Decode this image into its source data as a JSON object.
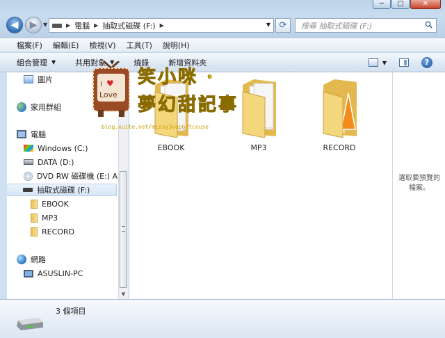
{
  "window": {
    "buttons": [
      "─",
      "□",
      "✕"
    ]
  },
  "navigation": {
    "address": {
      "root_label": "電腦",
      "current_label": "抽取式磁碟 (F:)"
    },
    "search": {
      "placeholder": "搜尋 抽取式磁碟 (F:)"
    }
  },
  "menu": [
    "檔案(F)",
    "編輯(E)",
    "檢視(V)",
    "工具(T)",
    "說明(H)"
  ],
  "commandbar": {
    "organize": "組合管理",
    "share": "共用對象",
    "burn": "燒錄",
    "new_folder": "新增資料夾"
  },
  "navpane": {
    "items": [
      {
        "label": "圖片",
        "icon": "pictures-icon"
      },
      {
        "label": "家用群組",
        "icon": "homegroup-icon"
      },
      {
        "label": "電腦",
        "icon": "computer-icon"
      },
      {
        "label": "Windows (C:)",
        "icon": "windows-drive-icon"
      },
      {
        "label": "DATA (D:)",
        "icon": "drive-icon"
      },
      {
        "label": "DVD RW 磁碟機 (E:) Au",
        "icon": "dvd-icon"
      },
      {
        "label": "抽取式磁碟 (F:)",
        "icon": "usb-drive-icon"
      },
      {
        "label": "EBOOK",
        "icon": "folder-icon"
      },
      {
        "label": "MP3",
        "icon": "folder-icon"
      },
      {
        "label": "RECORD",
        "icon": "folder-icon"
      },
      {
        "label": "網路",
        "icon": "network-icon"
      },
      {
        "label": "ASUSLIN-PC",
        "icon": "pc-icon"
      }
    ]
  },
  "folders": [
    {
      "name": "EBOOK"
    },
    {
      "name": "MP3"
    },
    {
      "name": "RECORD"
    }
  ],
  "preview_pane": {
    "message": "選取要預覽的檔案。"
  },
  "status": {
    "item_count": "3 個項目"
  },
  "watermark": {
    "badge": "I Love",
    "line1": "笑小咪 ·",
    "line2": "夢幻甜記事",
    "url": "blog.xuite.net/missy3vup6/tcouse"
  },
  "colors": {
    "accent": "#2f6db5",
    "selection": "#d6e6f7",
    "folder": "#e8c05a"
  }
}
